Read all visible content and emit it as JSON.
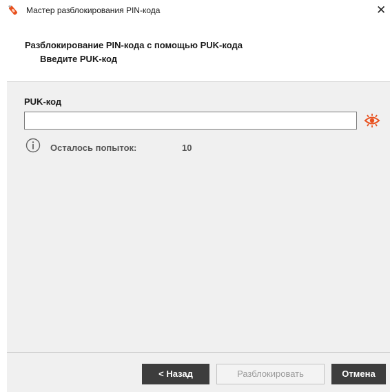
{
  "window": {
    "title": "Мастер разблокирования PIN-кода",
    "close_symbol": "✕",
    "app_icon": "usb-token-icon"
  },
  "header": {
    "title": "Разблокирование PIN-кода с помощью PUK-кода",
    "subtitle": "Введите PUK-код"
  },
  "form": {
    "puk_label": "PUK-код",
    "puk_value": "",
    "puk_placeholder": "",
    "show_password_icon": "eye-icon",
    "info_icon": "info-icon",
    "attempts_label": "Осталось попыток:",
    "attempts_value": "10"
  },
  "footer": {
    "back_label": "< Назад",
    "unlock_label": "Разблокировать",
    "unlock_enabled": false,
    "cancel_label": "Отмена"
  },
  "colors": {
    "accent": "#e8501d",
    "dark_button": "#3d3d3d",
    "panel_bg": "#f0f0f0"
  }
}
